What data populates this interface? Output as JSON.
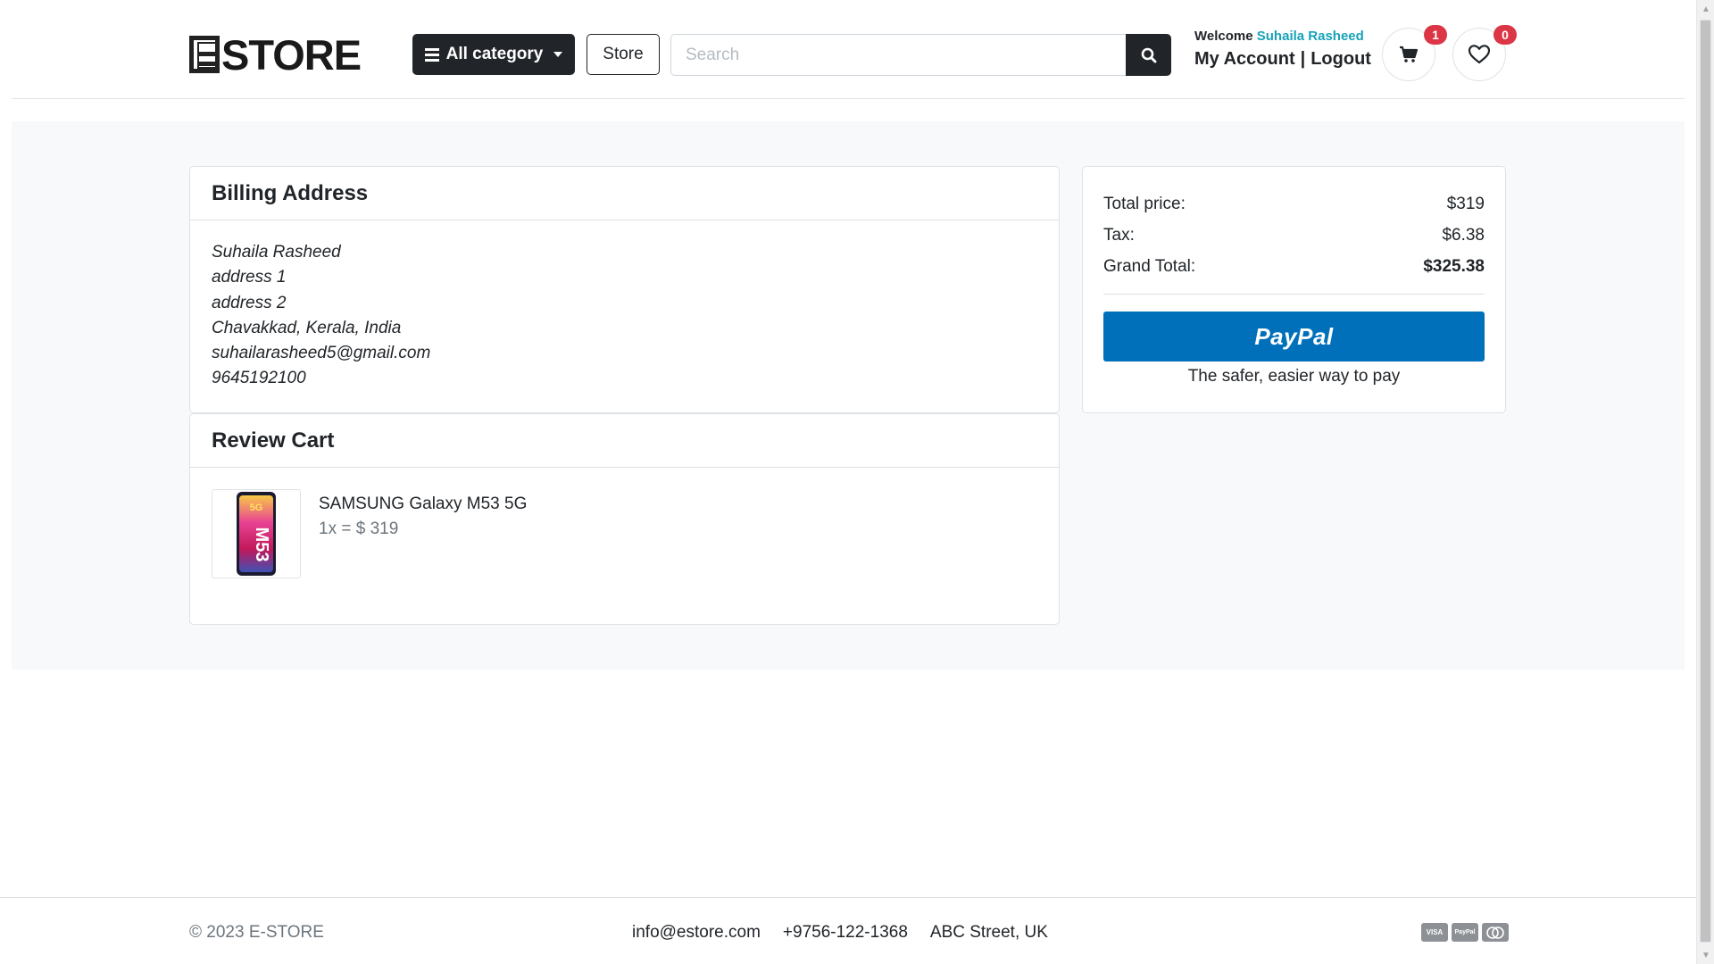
{
  "header": {
    "logo_text": "STORE",
    "category_label": "All category",
    "store_label": "Store",
    "search_placeholder": "Search",
    "welcome_prefix": "Welcome",
    "user_name": "Suhaila Rasheed",
    "my_account_label": "My Account",
    "separator": "|",
    "logout_label": "Logout",
    "cart_count": "1",
    "wishlist_count": "0"
  },
  "billing": {
    "title": "Billing Address",
    "lines": [
      "Suhaila Rasheed",
      "address 1",
      "address 2",
      "Chavakkad, Kerala, India",
      "suhailarasheed5@gmail.com",
      "9645192100"
    ]
  },
  "review": {
    "title": "Review Cart",
    "items": [
      {
        "name": "SAMSUNG Galaxy M53 5G",
        "price_line": "1x = $ 319"
      }
    ]
  },
  "summary": {
    "total_label": "Total price:",
    "total_value": "$319",
    "tax_label": "Tax:",
    "tax_value": "$6.38",
    "grand_label": "Grand Total:",
    "grand_value": "$325.38",
    "paypal_label": "PayPal",
    "paypal_tagline": "The safer, easier way to pay"
  },
  "footer": {
    "copyright": "© 2023 E-STORE",
    "email": "info@estore.com",
    "phone": "+9756-122-1368",
    "address": "ABC Street, UK",
    "payment_icons": [
      "VISA",
      "PayPal",
      "mastercard"
    ]
  },
  "colors": {
    "accent_user": "#17a2b8",
    "paypal_blue": "#0070ba",
    "badge_red": "#dc3545",
    "dark": "#212529"
  }
}
